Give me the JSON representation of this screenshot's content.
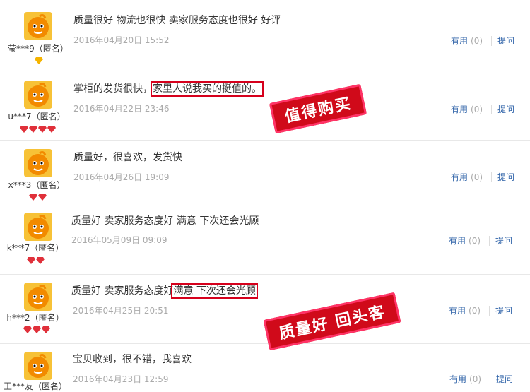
{
  "reviews": [
    {
      "user": "莹***9（匿名）",
      "gems": 1,
      "gem_style": "gold",
      "text": "质量很好 物流也很快 卖家服务态度也很好 好评",
      "date": "2016年04月20日 15:52",
      "useful": "有用",
      "count": "(0)",
      "ask": "提问"
    },
    {
      "user": "u***7（匿名）",
      "gems": 4,
      "gem_style": "red",
      "text_a": "掌柜的发货很快，",
      "text_b": "家里人说我买的挺值的。",
      "date": "2016年04月22日 23:46",
      "useful": "有用",
      "count": "(0)",
      "ask": "提问"
    },
    {
      "user": "x***3（匿名）",
      "gems": 2,
      "gem_style": "red",
      "text": "质量好，很喜欢，发货快",
      "date": "2016年04月26日 19:09",
      "useful": "有用",
      "count": "(0)",
      "ask": "提问"
    },
    {
      "user": "k***7（匿名）",
      "gems": 2,
      "gem_style": "red",
      "text": "质量好 卖家服务态度好 满意 下次还会光顾",
      "date": "2016年05月09日 09:09",
      "useful": "有用",
      "count": "(0)",
      "ask": "提问"
    },
    {
      "user": "h***2（匿名）",
      "gems": 3,
      "gem_style": "red",
      "text_a": "质量好 卖家服务态度好",
      "text_b": "满意 下次还会光顾",
      "date": "2016年04月25日 20:51",
      "useful": "有用",
      "count": "(0)",
      "ask": "提问"
    },
    {
      "user": "王***友（匿名）",
      "gems": 0,
      "gem_style": "red",
      "text": "宝贝收到，很不错，我喜欢",
      "date": "2016年04月23日 12:59",
      "useful": "有用",
      "count": "(0)",
      "ask": "提问"
    }
  ],
  "stamps": {
    "stamp1": "值得购买",
    "stamp2": "质量好 回头客"
  },
  "colors": {
    "stamp": "#d00a1a",
    "highlight": "#d6001c",
    "link": "#3366aa",
    "avatar": "#f7c237"
  }
}
